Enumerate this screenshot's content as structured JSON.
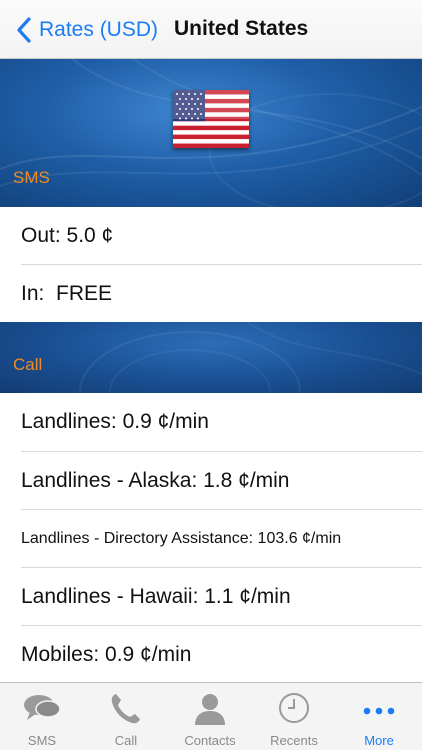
{
  "navbar": {
    "back_label": "Rates (USD)",
    "title": "United States"
  },
  "hero": {
    "flag_icon": "us-flag-icon",
    "sms_label": "SMS"
  },
  "sms_rates": [
    {
      "text": "Out: 5.0 ¢"
    },
    {
      "text": "In:  FREE"
    }
  ],
  "call_section": {
    "label": "Call"
  },
  "call_rates": [
    {
      "text": "Landlines: 0.9 ¢/min"
    },
    {
      "text": "Landlines - Alaska: 1.8 ¢/min"
    },
    {
      "text": "Landlines - Directory Assistance: 103.6 ¢/min"
    },
    {
      "text": "Landlines - Hawaii: 1.1 ¢/min"
    },
    {
      "text": "Mobiles: 0.9 ¢/min"
    }
  ],
  "tabbar": {
    "tabs": [
      {
        "label": "SMS",
        "icon": "speech-bubbles-icon"
      },
      {
        "label": "Call",
        "icon": "phone-handset-icon"
      },
      {
        "label": "Contacts",
        "icon": "person-silhouette-icon"
      },
      {
        "label": "Recents",
        "icon": "clock-icon"
      },
      {
        "label": "More",
        "icon": "more-dots-icon"
      }
    ],
    "active_index": 4
  },
  "colors": {
    "accent": "#1c7cf4",
    "section_label": "#f08a22",
    "hero_blue": "#1f5fa8"
  }
}
